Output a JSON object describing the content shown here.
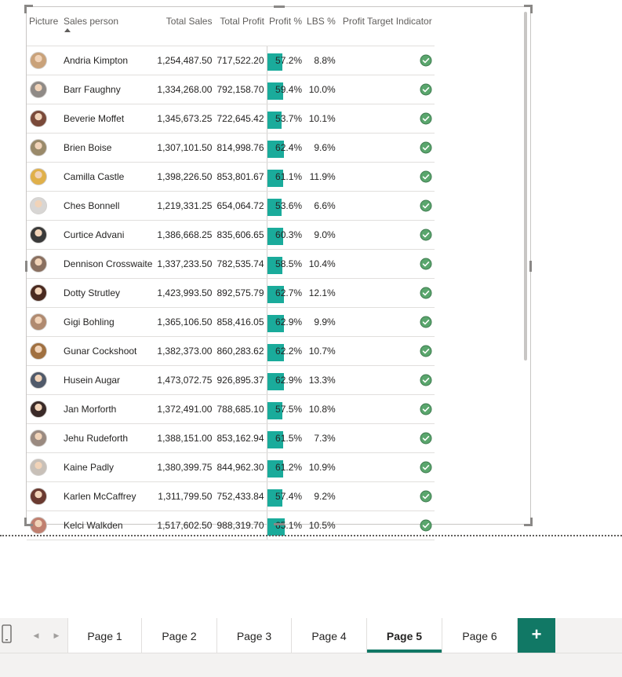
{
  "table": {
    "columns": {
      "picture": "Picture",
      "sales_person": "Sales person",
      "total_sales": "Total Sales",
      "total_profit": "Total Profit",
      "profit_pct": "Profit %",
      "lbs_pct": "LBS %",
      "indicator": "Profit Target Indicator"
    },
    "sort": {
      "column": "Sales person",
      "direction": "ascending"
    },
    "colors": {
      "bar": "#1aab9b",
      "check_fill": "#5aa66d"
    },
    "rows": [
      {
        "name": "Andria Kimpton",
        "total_sales": "1,254,487.50",
        "total_profit": "717,522.20",
        "profit_pct": "57.2%",
        "profit_pct_value": 57.2,
        "lbs_pct": "8.8%",
        "indicator_icon": "check-circle-icon"
      },
      {
        "name": "Barr Faughny",
        "total_sales": "1,334,268.00",
        "total_profit": "792,158.70",
        "profit_pct": "59.4%",
        "profit_pct_value": 59.4,
        "lbs_pct": "10.0%",
        "indicator_icon": "check-circle-icon"
      },
      {
        "name": "Beverie Moffet",
        "total_sales": "1,345,673.25",
        "total_profit": "722,645.42",
        "profit_pct": "53.7%",
        "profit_pct_value": 53.7,
        "lbs_pct": "10.1%",
        "indicator_icon": "check-circle-icon"
      },
      {
        "name": "Brien Boise",
        "total_sales": "1,307,101.50",
        "total_profit": "814,998.76",
        "profit_pct": "62.4%",
        "profit_pct_value": 62.4,
        "lbs_pct": "9.6%",
        "indicator_icon": "check-circle-icon"
      },
      {
        "name": "Camilla Castle",
        "total_sales": "1,398,226.50",
        "total_profit": "853,801.67",
        "profit_pct": "61.1%",
        "profit_pct_value": 61.1,
        "lbs_pct": "11.9%",
        "indicator_icon": "check-circle-icon"
      },
      {
        "name": "Ches Bonnell",
        "total_sales": "1,219,331.25",
        "total_profit": "654,064.72",
        "profit_pct": "53.6%",
        "profit_pct_value": 53.6,
        "lbs_pct": "6.6%",
        "indicator_icon": "check-circle-icon"
      },
      {
        "name": "Curtice Advani",
        "total_sales": "1,386,668.25",
        "total_profit": "835,606.65",
        "profit_pct": "60.3%",
        "profit_pct_value": 60.3,
        "lbs_pct": "9.0%",
        "indicator_icon": "check-circle-icon"
      },
      {
        "name": "Dennison Crosswaite",
        "total_sales": "1,337,233.50",
        "total_profit": "782,535.74",
        "profit_pct": "58.5%",
        "profit_pct_value": 58.5,
        "lbs_pct": "10.4%",
        "indicator_icon": "check-circle-icon"
      },
      {
        "name": "Dotty Strutley",
        "total_sales": "1,423,993.50",
        "total_profit": "892,575.79",
        "profit_pct": "62.7%",
        "profit_pct_value": 62.7,
        "lbs_pct": "12.1%",
        "indicator_icon": "check-circle-icon"
      },
      {
        "name": "Gigi Bohling",
        "total_sales": "1,365,106.50",
        "total_profit": "858,416.05",
        "profit_pct": "62.9%",
        "profit_pct_value": 62.9,
        "lbs_pct": "9.9%",
        "indicator_icon": "check-circle-icon"
      },
      {
        "name": "Gunar Cockshoot",
        "total_sales": "1,382,373.00",
        "total_profit": "860,283.62",
        "profit_pct": "62.2%",
        "profit_pct_value": 62.2,
        "lbs_pct": "10.7%",
        "indicator_icon": "check-circle-icon"
      },
      {
        "name": "Husein Augar",
        "total_sales": "1,473,072.75",
        "total_profit": "926,895.37",
        "profit_pct": "62.9%",
        "profit_pct_value": 62.9,
        "lbs_pct": "13.3%",
        "indicator_icon": "check-circle-icon"
      },
      {
        "name": "Jan Morforth",
        "total_sales": "1,372,491.00",
        "total_profit": "788,685.10",
        "profit_pct": "57.5%",
        "profit_pct_value": 57.5,
        "lbs_pct": "10.8%",
        "indicator_icon": "check-circle-icon"
      },
      {
        "name": "Jehu Rudeforth",
        "total_sales": "1,388,151.00",
        "total_profit": "853,162.94",
        "profit_pct": "61.5%",
        "profit_pct_value": 61.5,
        "lbs_pct": "7.3%",
        "indicator_icon": "check-circle-icon"
      },
      {
        "name": "Kaine Padly",
        "total_sales": "1,380,399.75",
        "total_profit": "844,962.30",
        "profit_pct": "61.2%",
        "profit_pct_value": 61.2,
        "lbs_pct": "10.9%",
        "indicator_icon": "check-circle-icon"
      },
      {
        "name": "Karlen McCaffrey",
        "total_sales": "1,311,799.50",
        "total_profit": "752,433.84",
        "profit_pct": "57.4%",
        "profit_pct_value": 57.4,
        "lbs_pct": "9.2%",
        "indicator_icon": "check-circle-icon"
      },
      {
        "name": "Kelci Walkden",
        "total_sales": "1,517,602.50",
        "total_profit": "988,319.70",
        "profit_pct": "65.1%",
        "profit_pct_value": 65.1,
        "lbs_pct": "10.5%",
        "indicator_icon": "check-circle-icon"
      }
    ]
  },
  "page_tabs": {
    "pages": [
      "Page 1",
      "Page 2",
      "Page 3",
      "Page 4",
      "Page 5",
      "Page 6"
    ],
    "active": "Page 5",
    "add_label": "+",
    "accent_color": "#117865"
  }
}
